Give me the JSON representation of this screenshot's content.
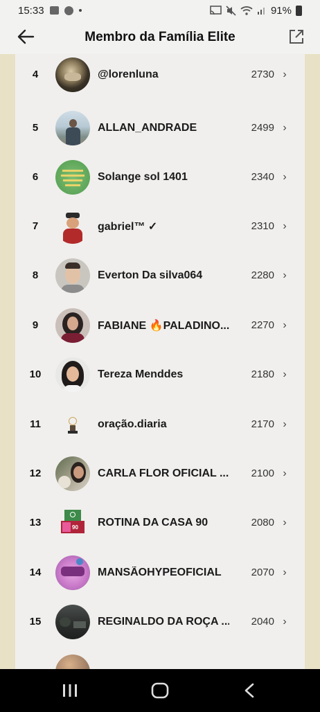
{
  "status_bar": {
    "time": "15:33",
    "battery": "91%"
  },
  "header": {
    "title": "Membro da Família Elite"
  },
  "members": [
    {
      "rank": "4",
      "name": "@lorenluna",
      "score": "2730",
      "avatar": "tiger-avatar"
    },
    {
      "rank": "5",
      "name": "ALLAN_ANDRADE",
      "score": "2499",
      "avatar": "man-outdoor-avatar"
    },
    {
      "rank": "6",
      "name": "Solange sol 1401",
      "score": "2340",
      "avatar": "green-text-avatar"
    },
    {
      "rank": "7",
      "name": "gabriel™ ✓",
      "score": "2310",
      "avatar": "cartoon-man-avatar"
    },
    {
      "rank": "8",
      "name": "Everton Da silva064",
      "score": "2280",
      "avatar": "man-portrait-avatar"
    },
    {
      "rank": "9",
      "name": "FABIANE 🔥PALADINO...",
      "score": "2270",
      "avatar": "woman-portrait-avatar"
    },
    {
      "rank": "10",
      "name": "Tereza Menddes",
      "score": "2180",
      "avatar": "woman-smiling-avatar"
    },
    {
      "rank": "11",
      "name": "oração.diaria",
      "score": "2170",
      "avatar": "prayer-avatar"
    },
    {
      "rank": "12",
      "name": "CARLA FLOR OFICIAL ...",
      "score": "2100",
      "avatar": "woman-flower-avatar"
    },
    {
      "rank": "13",
      "name": "ROTINA DA CASA 90",
      "score": "2080",
      "avatar": "house-90-avatar"
    },
    {
      "rank": "14",
      "name": "MANSÃOHYPEOFICIAL",
      "score": "2070",
      "avatar": "pink-logo-avatar"
    },
    {
      "rank": "15",
      "name": "REGINALDO DA ROÇA ...",
      "score": "2040",
      "avatar": "dark-landscape-avatar"
    }
  ],
  "colors": {
    "list_bg": "#f0efed",
    "side_bg": "#e8e1c6",
    "header_bg": "#f2f2f1"
  }
}
